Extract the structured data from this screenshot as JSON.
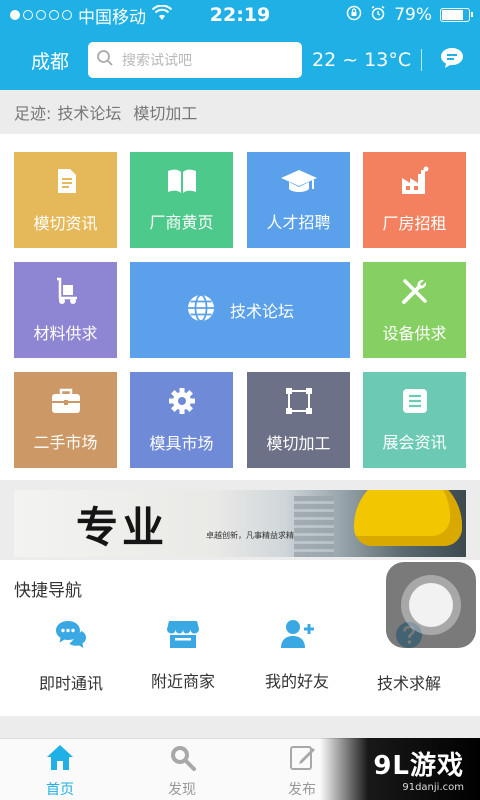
{
  "status_bar": {
    "carrier": "中国移动",
    "time": "22:19",
    "battery_percent": "79%",
    "battery_level": 0.79,
    "signal_icon": "signal-dots-icon",
    "wifi_icon": "wifi-icon"
  },
  "header": {
    "city": "成都",
    "search_placeholder": "搜索试试吧",
    "temperature": "22 ~ 13°C",
    "message_icon": "chat-bubble-icon",
    "accent_color": "#1fb0e6"
  },
  "breadcrumb": {
    "label": "足迹:",
    "items": [
      "技术论坛",
      "模切加工"
    ]
  },
  "tiles": [
    {
      "label": "模切资讯",
      "icon": "document-icon",
      "color": "#e5b859"
    },
    {
      "label": "厂商黄页",
      "icon": "book-icon",
      "color": "#4dc98b"
    },
    {
      "label": "人才招聘",
      "icon": "graduation-cap-icon",
      "color": "#5aa0ea"
    },
    {
      "label": "厂房招租",
      "icon": "factory-icon",
      "color": "#f3805f"
    },
    {
      "label": "材料供求",
      "icon": "hand-truck-icon",
      "color": "#8f86d3"
    },
    {
      "label": "技术论坛",
      "icon": "globe-icon",
      "color": "#5aa0ea"
    },
    {
      "label": "设备供求",
      "icon": "tools-icon",
      "color": "#86cf62"
    },
    {
      "label": "二手市场",
      "icon": "briefcase-icon",
      "color": "#cc9865"
    },
    {
      "label": "模具市场",
      "icon": "gear-icon",
      "color": "#6f8bd8"
    },
    {
      "label": "模切加工",
      "icon": "crop-frame-icon",
      "color": "#6c7188"
    },
    {
      "label": "展会资讯",
      "icon": "list-icon",
      "color": "#6ccab4"
    }
  ],
  "banner": {
    "title": "专业",
    "subtitle": "卓越创新，凡事精益求精"
  },
  "quick_nav": {
    "title": "快捷导航",
    "items": [
      {
        "label": "即时通讯",
        "icon": "chat-bubbles-icon"
      },
      {
        "label": "附近商家",
        "icon": "store-icon"
      },
      {
        "label": "我的好友",
        "icon": "add-friend-icon"
      },
      {
        "label": "技术求解",
        "icon": "question-icon"
      }
    ]
  },
  "tab_bar": {
    "items": [
      {
        "label": "首页",
        "icon": "home-icon",
        "active": true
      },
      {
        "label": "发现",
        "icon": "search-icon",
        "active": false
      },
      {
        "label": "发布",
        "icon": "edit-icon",
        "active": false
      }
    ]
  },
  "watermark": {
    "logo": "9L游戏",
    "url": "91danji.com"
  }
}
